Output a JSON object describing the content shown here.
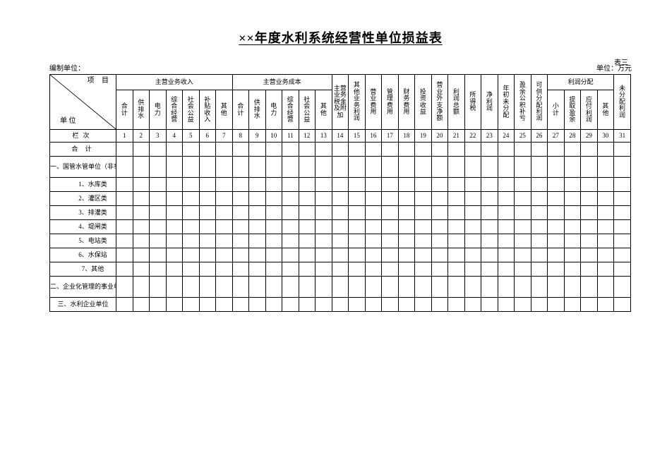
{
  "title": "××年度水利系统经营性单位损益表",
  "table_number": "表三",
  "meta": {
    "compiler_label": "编制单位：",
    "unit_label": "单位：万元"
  },
  "corner": {
    "top": "项 目",
    "bottom": "单 位"
  },
  "group_headers": {
    "revenue": "主营业务收入",
    "cost": "主营业务成本",
    "profit_dist": "利润分配"
  },
  "sub_headers": {
    "c1": "合\n计",
    "c2": "供\n排\n水",
    "c3": "电\n力",
    "c4": "综\n合\n经\n营",
    "c5": "社\n会\n公\n益",
    "c6": "补\n贴\n收\n入",
    "c7": "其\n他",
    "c8": "合\n计",
    "c9": "供\n排\n水",
    "c10": "电\n力",
    "c11": "综\n合\n经\n营",
    "c12": "社\n会\n公\n益",
    "c13": "其\n他",
    "c14": "主营\n业务\n税金\n及附\n加",
    "c15": "其\n他\n业\n务\n利\n润",
    "c16": "营\n业\n费\n用",
    "c17": "管\n理\n费\n用",
    "c18": "财\n务\n费\n用",
    "c19": "投\n资\n收\n益",
    "c20": "营\n业\n外\n支\n净\n额",
    "c21": "利\n润\n总\n额",
    "c22": "所\n得\n税",
    "c23": "净\n利\n润",
    "c24": "年\n初\n未\n分\n配",
    "c25": "盈\n余\n公\n积\n补\n亏",
    "c26": "可\n供\n分\n配\n利\n润",
    "c27": "小\n计",
    "c28": "提\n取\n盈\n余",
    "c29": "应\n付\n利\n润",
    "c30": "其\n他",
    "c31": "未\n分\n配\n利\n润"
  },
  "col_count": 31,
  "row_number_label": "栏次",
  "rows": [
    {
      "label": "合  计",
      "class": "center"
    },
    {
      "label": "一、国管水管单位（非事业化）",
      "class": "",
      "tall": true
    },
    {
      "label": "1、水库类",
      "class": "indent"
    },
    {
      "label": "2、灌区类",
      "class": "indent"
    },
    {
      "label": "3、排灌类",
      "class": "indent"
    },
    {
      "label": "4、堤闸类",
      "class": "indent"
    },
    {
      "label": "5、电站类",
      "class": "indent"
    },
    {
      "label": "6、水保站",
      "class": "indent"
    },
    {
      "label": "7、其他",
      "class": "indent"
    },
    {
      "label": "二、企业化管理的事业单位",
      "class": "",
      "tall": true
    },
    {
      "label": "三、水利企业单位",
      "class": ""
    }
  ],
  "chart_data": {
    "type": "table",
    "title": "××年度水利系统经营性单位损益表",
    "column_index_label": "栏次",
    "columns": [
      {
        "n": 1,
        "group": "主营业务收入",
        "label": "合计"
      },
      {
        "n": 2,
        "group": "主营业务收入",
        "label": "供排水"
      },
      {
        "n": 3,
        "group": "主营业务收入",
        "label": "电力"
      },
      {
        "n": 4,
        "group": "主营业务收入",
        "label": "综合经营"
      },
      {
        "n": 5,
        "group": "主营业务收入",
        "label": "社会公益"
      },
      {
        "n": 6,
        "group": "主营业务收入",
        "label": "补贴收入"
      },
      {
        "n": 7,
        "group": "主营业务收入",
        "label": "其他"
      },
      {
        "n": 8,
        "group": "主营业务成本",
        "label": "合计"
      },
      {
        "n": 9,
        "group": "主营业务成本",
        "label": "供排水"
      },
      {
        "n": 10,
        "group": "主营业务成本",
        "label": "电力"
      },
      {
        "n": 11,
        "group": "主营业务成本",
        "label": "综合经营"
      },
      {
        "n": 12,
        "group": "主营业务成本",
        "label": "社会公益"
      },
      {
        "n": 13,
        "group": "主营业务成本",
        "label": "其他"
      },
      {
        "n": 14,
        "group": "",
        "label": "主营业务税金及附加"
      },
      {
        "n": 15,
        "group": "",
        "label": "其他业务利润"
      },
      {
        "n": 16,
        "group": "",
        "label": "营业费用"
      },
      {
        "n": 17,
        "group": "",
        "label": "管理费用"
      },
      {
        "n": 18,
        "group": "",
        "label": "财务费用"
      },
      {
        "n": 19,
        "group": "",
        "label": "投资收益"
      },
      {
        "n": 20,
        "group": "",
        "label": "营业外支净额"
      },
      {
        "n": 21,
        "group": "",
        "label": "利润总额"
      },
      {
        "n": 22,
        "group": "",
        "label": "所得税"
      },
      {
        "n": 23,
        "group": "",
        "label": "净利润"
      },
      {
        "n": 24,
        "group": "",
        "label": "年初未分配"
      },
      {
        "n": 25,
        "group": "",
        "label": "盈余公积补亏"
      },
      {
        "n": 26,
        "group": "",
        "label": "可供分配利润"
      },
      {
        "n": 27,
        "group": "利润分配",
        "label": "小计"
      },
      {
        "n": 28,
        "group": "利润分配",
        "label": "提取盈余"
      },
      {
        "n": 29,
        "group": "利润分配",
        "label": "应付利润"
      },
      {
        "n": 30,
        "group": "利润分配",
        "label": "其他"
      },
      {
        "n": 31,
        "group": "",
        "label": "未分配利润"
      }
    ],
    "rows": [
      "合计",
      "一、国管水管单位（非事业化）",
      "1、水库类",
      "2、灌区类",
      "3、排灌类",
      "4、堤闸类",
      "5、电站类",
      "6、水保站",
      "7、其他",
      "二、企业化管理的事业单位",
      "三、水利企业单位"
    ],
    "values": null,
    "note": "表格主体为空，无数据值"
  }
}
